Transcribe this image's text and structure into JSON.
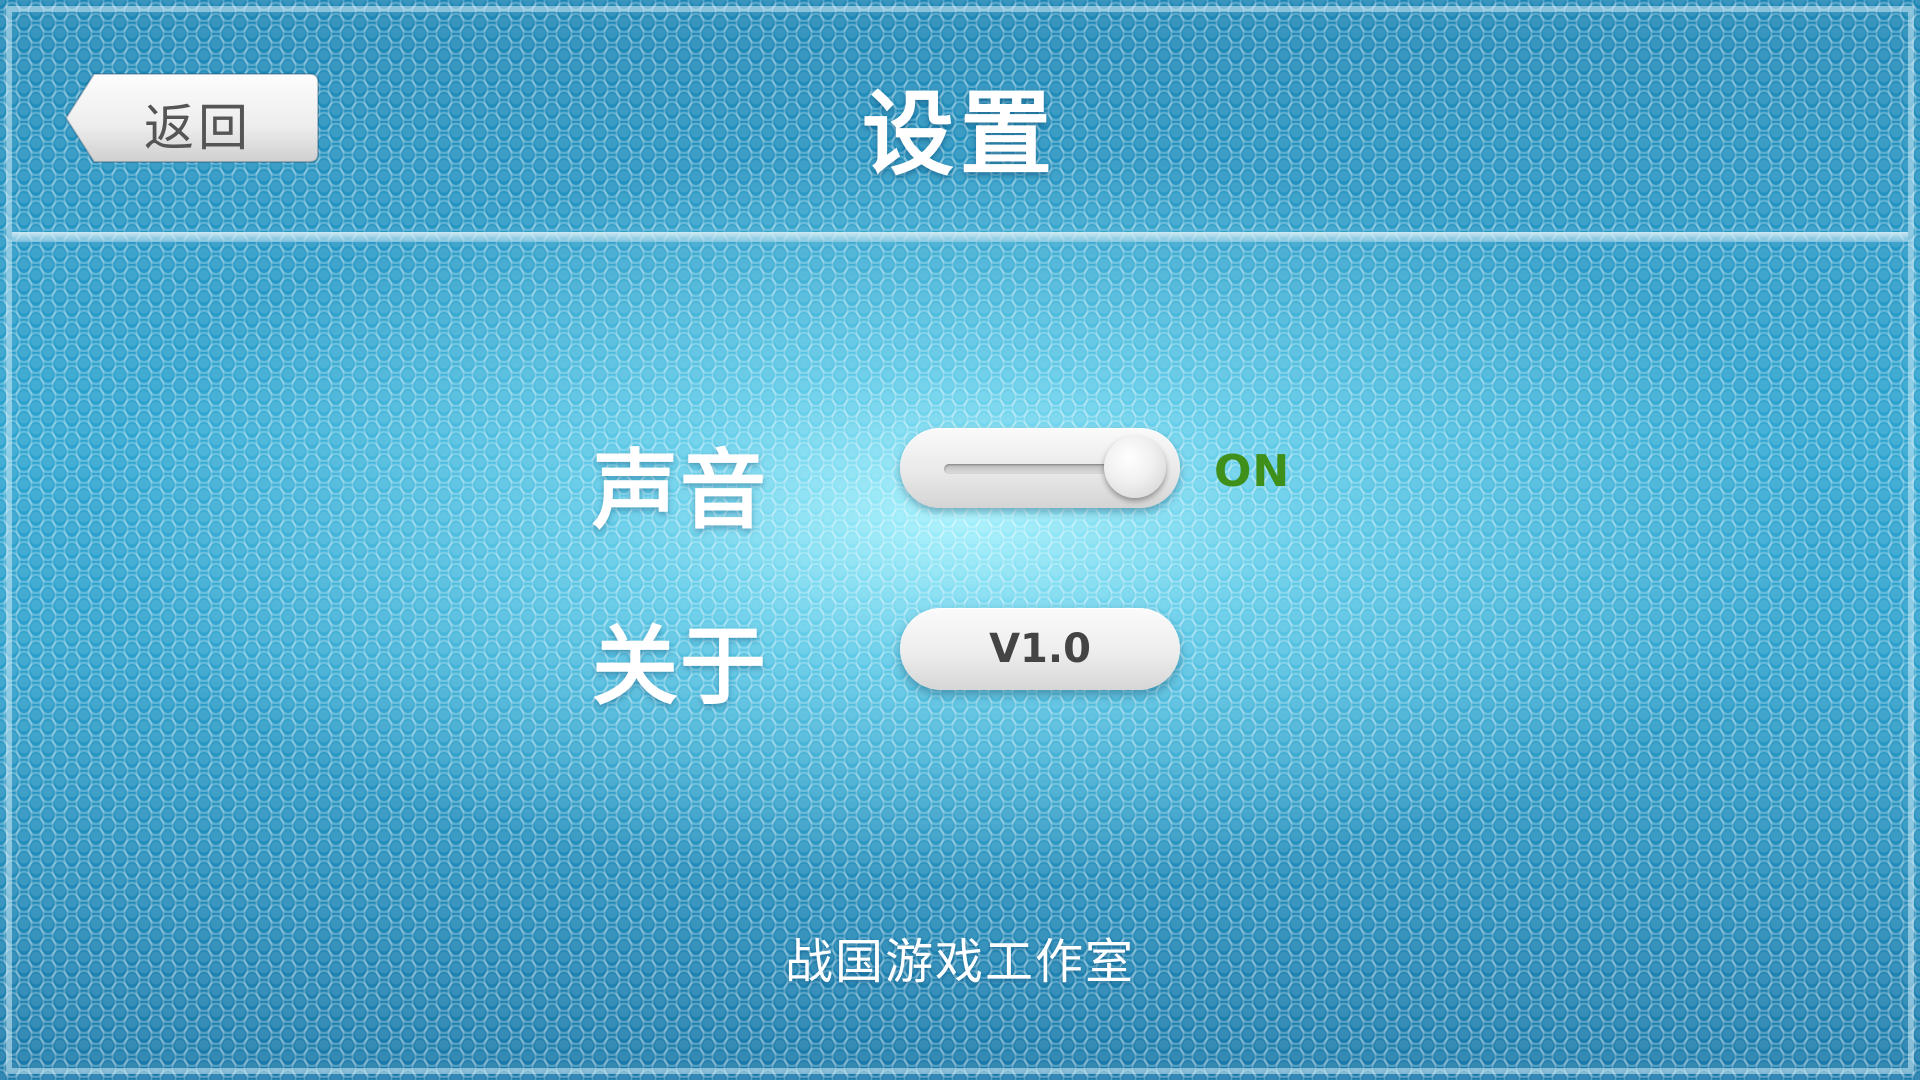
{
  "header": {
    "back_label": "返回",
    "title": "设置"
  },
  "settings": {
    "sound": {
      "label": "声音",
      "status": "ON",
      "enabled": true
    },
    "about": {
      "label": "关于",
      "version": "V1.0"
    }
  },
  "footer": {
    "credit": "战国游戏工作室"
  },
  "colors": {
    "background": "#2aa3cf",
    "status_on": "#3f8f1b",
    "button_face": "#ededed"
  },
  "icons": {
    "back": "arrow-left-tab-icon"
  }
}
